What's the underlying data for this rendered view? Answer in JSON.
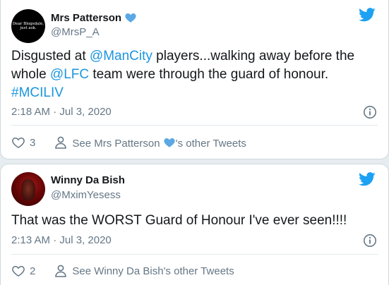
{
  "brand_color": "#1da1f2",
  "heart_color": "#5ba8e4",
  "tweets": [
    {
      "author_name": "Mrs Patterson",
      "author_handle": "@MrsP_A",
      "avatar_text_line1": "Dear Blogsdale,",
      "avatar_text_line2": "just ask.",
      "text_part1": "Disgusted at ",
      "mention1": "@ManCity",
      "text_part2": " players...walking away before the whole ",
      "mention2": "@LFC",
      "text_part3": " team were through the guard of honour.",
      "hashtag": "#MCILIV",
      "timestamp": "2:18 AM · Jul 3, 2020",
      "like_count": "3",
      "other_tweets_prefix": "See Mrs Patterson",
      "other_tweets_suffix": "'s other Tweets"
    },
    {
      "author_name": "Winny Da Bish",
      "author_handle": "@MximYesess",
      "text": "That was the WORST Guard of Honour I've ever seen!!!!",
      "timestamp": "2:13 AM · Jul 3, 2020",
      "like_count": "2",
      "other_tweets": "See Winny Da Bish's other Tweets"
    }
  ]
}
